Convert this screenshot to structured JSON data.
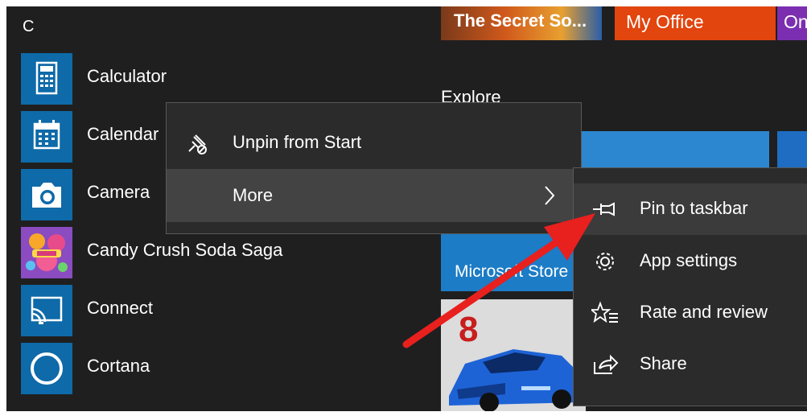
{
  "group_letter": "C",
  "apps": [
    {
      "name": "Calculator",
      "icon": "calculator-icon"
    },
    {
      "name": "Calendar",
      "icon": "calendar-icon"
    },
    {
      "name": "Camera",
      "icon": "camera-icon"
    },
    {
      "name": "Candy Crush Soda Saga",
      "icon": "candy-crush-icon"
    },
    {
      "name": "Connect",
      "icon": "connect-icon"
    },
    {
      "name": "Cortana",
      "icon": "cortana-icon"
    }
  ],
  "tiles": {
    "secret": "The Secret So...",
    "office": "My Office",
    "one": "On",
    "explore_heading": "Explore",
    "store": "Microsoft Store"
  },
  "context_menu": {
    "unpin": "Unpin from Start",
    "more": "More"
  },
  "submenu": {
    "pin_taskbar": "Pin to taskbar",
    "app_settings": "App settings",
    "rate_review": "Rate and review",
    "share": "Share"
  },
  "colors": {
    "tile_blue": "#0e6aa8",
    "menu_bg": "#2b2b2b",
    "menu_highlight": "#434343",
    "annotation_arrow": "#e8201e"
  }
}
